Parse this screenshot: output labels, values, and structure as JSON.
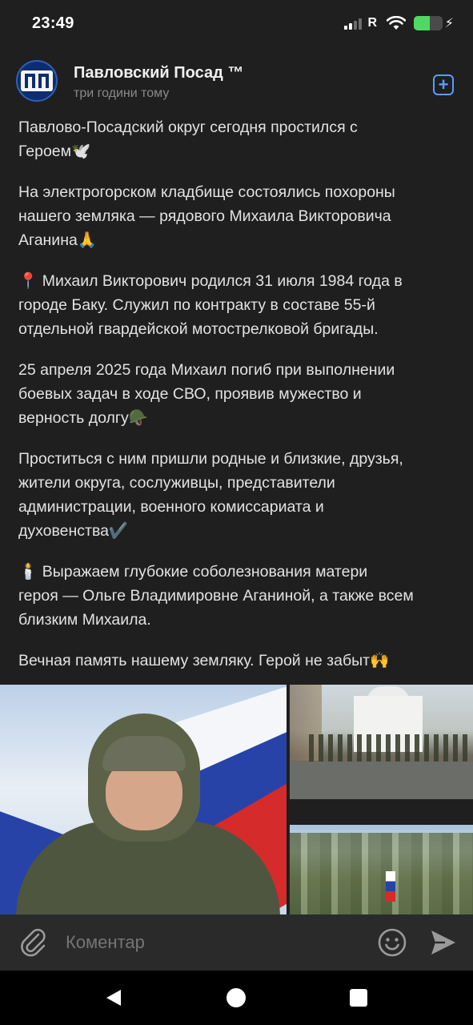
{
  "status_bar": {
    "time": "23:49",
    "network_letter": "R",
    "battery_level_fraction": 0.56
  },
  "post": {
    "channel_name": "Павловский Посад ™",
    "time_ago": "три години тому",
    "paragraphs": [
      "Павлово-Посадский округ сегодня простился с\nГероем🕊️",
      "На электрогорском кладбище состоялись похороны\nнашего земляка — рядового Михаила Викторовича\nАганина🙏",
      "📍 Михаил Викторович родился 31 июля 1984 года в\nгороде Баку. Служил по контракту в составе 55-й\nотдельной гвардейской мотострелковой бригады.",
      "25 апреля 2025 года Михаил погиб при выполнении\nбоевых задач в ходе СВО, проявив мужество и\nверность долгу🪖",
      "Проститься с ним пришли родные и близкие, друзья,\nжители округа, сослуживцы, представители\nадминистрации, военного комиссариата и\nдуховенства✔️",
      "🕯️ Выражаем глубокие соболезнования матери\nгероя — Ольге Владимировне Аганиной, а также всем\nблизким Михаила.",
      "Вечная память нашему земляку. Герой не забыт🙌"
    ]
  },
  "comment_bar": {
    "placeholder": "Коментар",
    "icons": [
      "paperclip-icon",
      "emoji-icon",
      "send-icon"
    ]
  },
  "colors": {
    "background": "#1f1f20",
    "accent": "#5a9cff",
    "text": "#e2e2e2",
    "muted": "#8a8a8a"
  }
}
